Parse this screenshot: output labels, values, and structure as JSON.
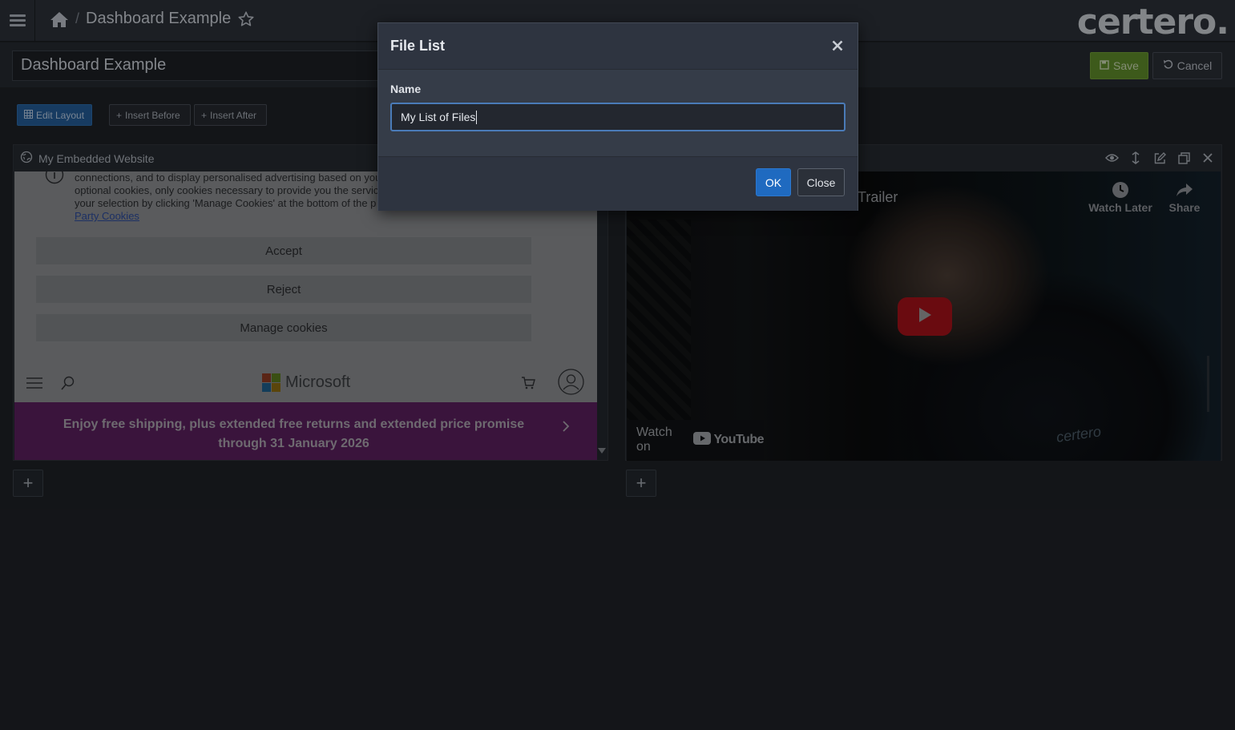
{
  "topbar": {
    "breadcrumb_title": "Dashboard Example",
    "separator": "/",
    "logo_text": "certero."
  },
  "titlebar": {
    "title_value": "Dashboard Example",
    "save_label": "Save",
    "cancel_label": "Cancel"
  },
  "toolbar": {
    "edit_layout_label": "Edit Layout",
    "insert_before_label": "Insert Before",
    "insert_after_label": "Insert After"
  },
  "panels": {
    "left": {
      "title": "My Embedded Website",
      "cookie_text_1": "connections, and to display personalised advertising based on your",
      "cookie_text_2": "optional cookies, only cookies necessary to provide you the service",
      "cookie_text_3": "your selection by clicking 'Manage Cookies' at the bottom of the p",
      "cookie_link": "Party Cookies",
      "accept_label": "Accept",
      "reject_label": "Reject",
      "manage_label": "Manage cookies",
      "brand_name": "Microsoft",
      "promo_text": "Enjoy free shipping, plus extended free returns and extended price promise through 31 January 2026"
    },
    "right": {
      "video_title_fragment": "Trailer",
      "watch_later_label": "Watch Later",
      "share_label": "Share",
      "watch_on_label": "Watch on",
      "youtube_label": "YouTube",
      "jacket_brand": "certero"
    }
  },
  "add_button_label": "+",
  "modal": {
    "title": "File List",
    "name_label": "Name",
    "name_value": "My List of Files",
    "ok_label": "OK",
    "close_label": "Close"
  },
  "colors": {
    "accent_blue": "#1f6ac0",
    "save_green": "#5e8a2a",
    "promo_purple": "#5a1f5c",
    "youtube_red": "#a3111a"
  }
}
